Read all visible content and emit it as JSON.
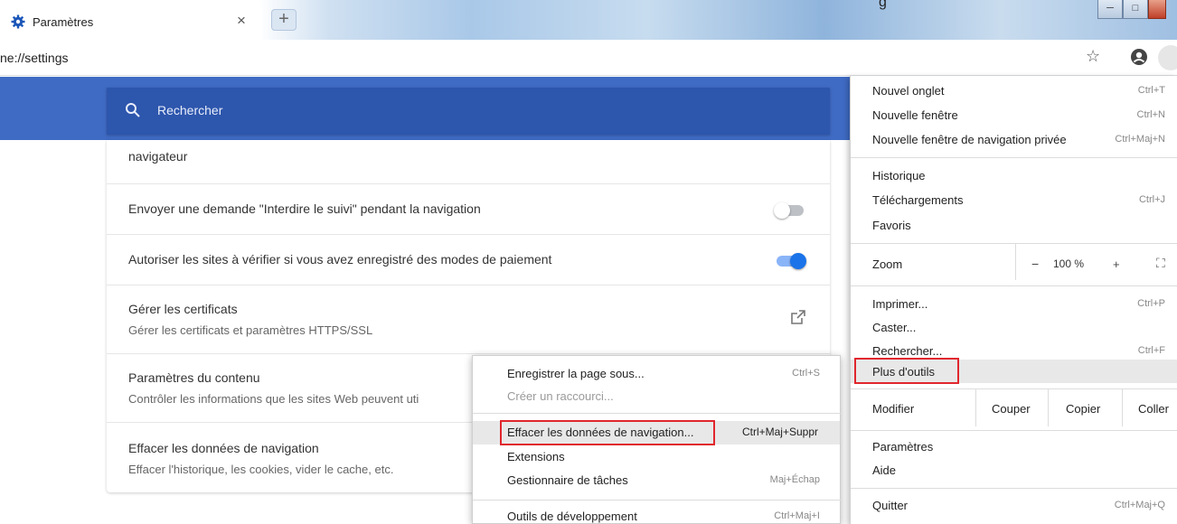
{
  "window": {
    "tab_title": "Paramètres",
    "tab_close": "×",
    "new_tab": "+",
    "top_stray_text": "g",
    "controls": {
      "minimize": "─",
      "maximize": "□",
      "close": ""
    }
  },
  "address_bar": {
    "url": "ne://settings",
    "star": "☆"
  },
  "settings": {
    "search_placeholder": "Rechercher",
    "clipped_row": {
      "title_line2": "navigateur"
    },
    "rows": [
      {
        "title": "Envoyer une demande \"Interdire le suivi\" pendant la navigation",
        "toggle": "off"
      },
      {
        "title": "Autoriser les sites à vérifier si vous avez enregistré des modes de paiement",
        "toggle": "on"
      },
      {
        "title": "Gérer les certificats",
        "subtitle": "Gérer les certificats et paramètres HTTPS/SSL"
      },
      {
        "title": "Paramètres du contenu",
        "subtitle": "Contrôler les informations que les sites Web peuvent uti"
      },
      {
        "title": "Effacer les données de navigation",
        "subtitle": "Effacer l'historique, les cookies, vider le cache, etc."
      }
    ]
  },
  "menu": {
    "new_tab": {
      "label": "Nouvel onglet",
      "shortcut": "Ctrl+T"
    },
    "new_window": {
      "label": "Nouvelle fenêtre",
      "shortcut": "Ctrl+N"
    },
    "incognito": {
      "label": "Nouvelle fenêtre de navigation privée",
      "shortcut": "Ctrl+Maj+N"
    },
    "history": {
      "label": "Historique"
    },
    "downloads": {
      "label": "Téléchargements",
      "shortcut": "Ctrl+J"
    },
    "bookmarks": {
      "label": "Favoris"
    },
    "zoom": {
      "label": "Zoom",
      "minus": "−",
      "value": "100 %",
      "plus": "+",
      "fullscreen": "⛶"
    },
    "print": {
      "label": "Imprimer...",
      "shortcut": "Ctrl+P"
    },
    "cast": {
      "label": "Caster..."
    },
    "find": {
      "label": "Rechercher...",
      "shortcut": "Ctrl+F"
    },
    "more_tools": {
      "label": "Plus d'outils"
    },
    "edit": {
      "label": "Modifier",
      "cut": "Couper",
      "copy": "Copier",
      "paste": "Coller"
    },
    "settings": {
      "label": "Paramètres"
    },
    "help": {
      "label": "Aide"
    },
    "quit": {
      "label": "Quitter",
      "shortcut": "Ctrl+Maj+Q"
    }
  },
  "submenu": {
    "save_page": {
      "label": "Enregistrer la page sous...",
      "shortcut": "Ctrl+S"
    },
    "create_shortcut": {
      "label": "Créer un raccourci..."
    },
    "clear_data": {
      "label": "Effacer les données de navigation...",
      "shortcut": "Ctrl+Maj+Suppr"
    },
    "extensions": {
      "label": "Extensions"
    },
    "task_manager": {
      "label": "Gestionnaire de tâches",
      "shortcut": "Maj+Échap"
    },
    "dev_tools": {
      "label": "Outils de développement",
      "shortcut": "Ctrl+Maj+I"
    }
  },
  "colors": {
    "accent": "#3f6bc4",
    "search_bg": "#2d56ad",
    "highlight_box": "#e0262d",
    "toggle_on": "#1a73e8"
  }
}
